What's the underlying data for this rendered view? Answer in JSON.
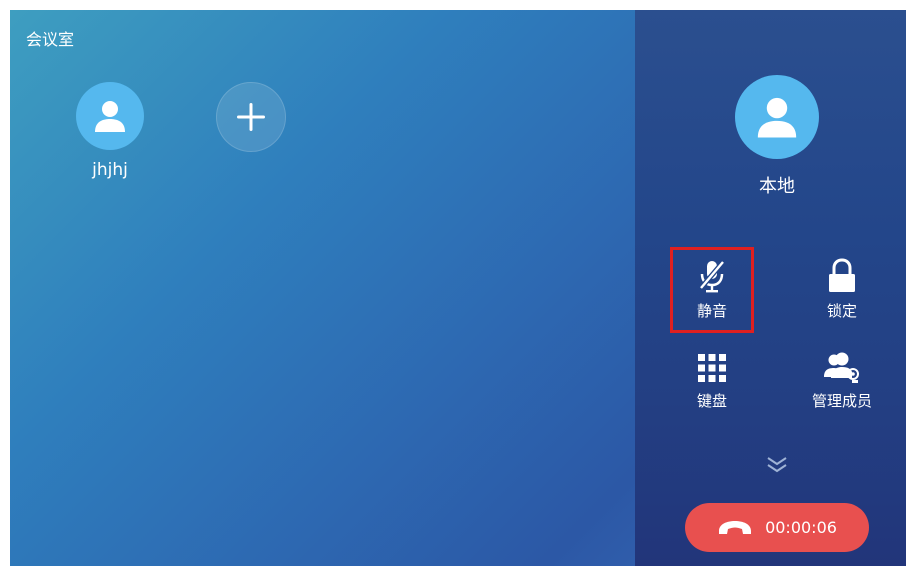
{
  "conference": {
    "title": "会议室"
  },
  "participants": [
    {
      "name": "jhjhj",
      "icon": "user-icon"
    }
  ],
  "add_participant": {
    "icon": "plus-icon"
  },
  "local": {
    "name": "本地",
    "icon": "user-icon"
  },
  "controls": {
    "mute": {
      "label": "静音",
      "icon": "mic-muted-icon",
      "highlighted": true
    },
    "lock": {
      "label": "锁定",
      "icon": "lock-icon"
    },
    "keypad": {
      "label": "键盘",
      "icon": "keypad-icon"
    },
    "manage": {
      "label": "管理成员",
      "icon": "manage-members-icon"
    }
  },
  "expand": {
    "icon": "double-chevron-down-icon"
  },
  "hangup": {
    "timer": "00:00:06",
    "icon": "hangup-phone-icon",
    "color": "#e8504f"
  },
  "colors": {
    "avatar": "#55b8ee",
    "highlight": "#e02020"
  }
}
